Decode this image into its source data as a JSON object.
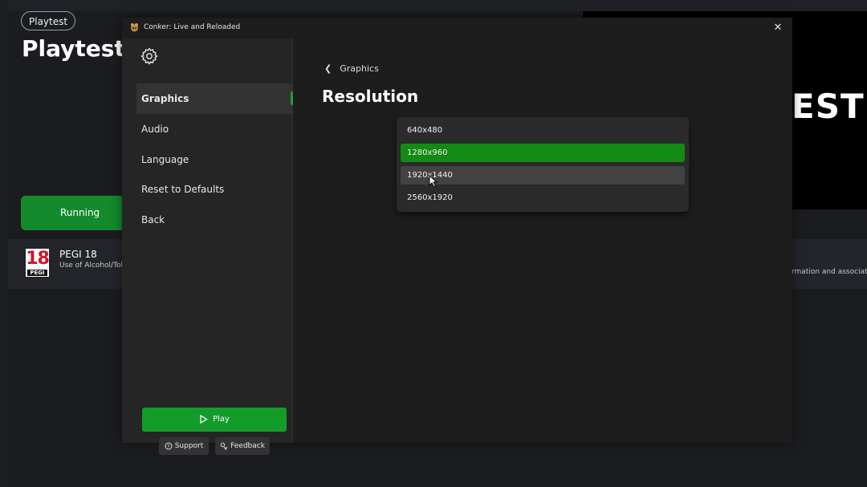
{
  "background": {
    "chip_label": "Playtest",
    "page_title": "Playtest:",
    "running_label": "Running",
    "rating": {
      "badge_number": "18",
      "badge_text": "PEGI",
      "title": "PEGI 18",
      "description": "Use of Alcohol/Tobacco"
    },
    "hero_text": "EST",
    "right_description": "rmation and associated"
  },
  "window": {
    "title": "Conker: Live and Reloaded",
    "close_icon": "close-icon"
  },
  "sidebar": {
    "settings_icon": "gear-icon",
    "items": [
      {
        "label": "Graphics",
        "active": true
      },
      {
        "label": "Audio",
        "active": false
      },
      {
        "label": "Language",
        "active": false
      },
      {
        "label": "Reset to Defaults",
        "active": false
      },
      {
        "label": "Back",
        "active": false
      }
    ],
    "play_label": "Play",
    "support_label": "Support",
    "feedback_label": "Feedback"
  },
  "main": {
    "breadcrumb": "Graphics",
    "title": "Resolution",
    "options": [
      {
        "label": "640x480",
        "state": "normal"
      },
      {
        "label": "1280x960",
        "state": "selected"
      },
      {
        "label": "1920x1440",
        "state": "hover"
      },
      {
        "label": "2560x1920",
        "state": "normal"
      }
    ]
  },
  "colors": {
    "accent_green": "#138a13",
    "play_green": "#149c2b",
    "running_green": "#138a2c"
  }
}
